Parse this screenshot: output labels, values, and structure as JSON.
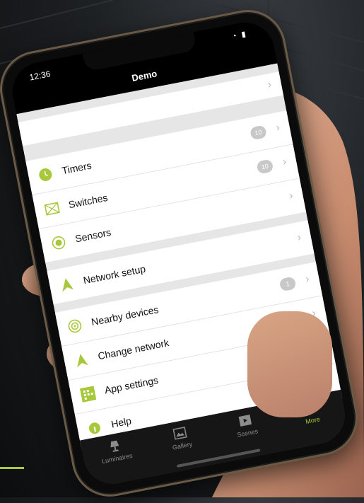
{
  "status": {
    "time": "12:36"
  },
  "nav": {
    "title": "Demo"
  },
  "menu": [
    {
      "label": "Timers",
      "icon": "clock-icon",
      "badge": "10"
    },
    {
      "label": "Switches",
      "icon": "switch-icon",
      "badge": "10"
    },
    {
      "label": "Sensors",
      "icon": "sensor-icon",
      "badge": ""
    },
    {
      "label": "Network setup",
      "icon": "network-icon",
      "badge": ""
    },
    {
      "label": "Nearby devices",
      "icon": "nearby-icon",
      "badge": "1"
    },
    {
      "label": "Change network",
      "icon": "change-network-icon",
      "badge": ""
    },
    {
      "label": "App settings",
      "icon": "settings-icon",
      "badge": ""
    },
    {
      "label": "Help",
      "icon": "help-icon",
      "badge": ""
    }
  ],
  "help_fab": "?",
  "tabs": [
    {
      "label": "Luminaires",
      "icon": "lamp-icon",
      "active": false
    },
    {
      "label": "Gallery",
      "icon": "gallery-icon",
      "active": false
    },
    {
      "label": "Scenes",
      "icon": "scenes-icon",
      "active": false
    },
    {
      "label": "More",
      "icon": "more-icon",
      "active": true
    }
  ],
  "colors": {
    "accent": "#a6c83a",
    "background": "#1e2124"
  }
}
